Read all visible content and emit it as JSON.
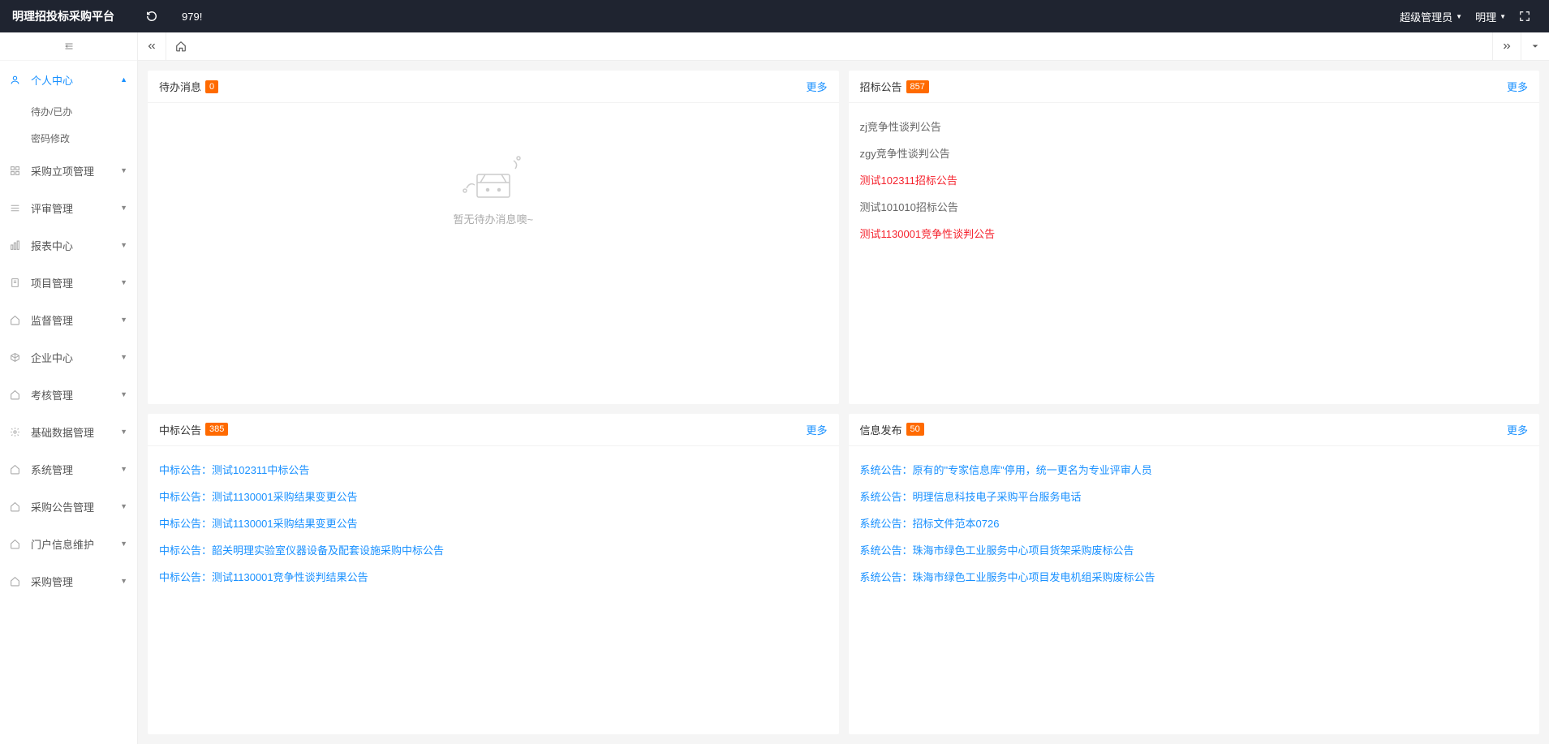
{
  "header": {
    "logo": "明理招投标采购平台",
    "ticker": "979!",
    "role": "超级管理员",
    "user": "明理"
  },
  "sidebar": {
    "items": [
      {
        "label": "个人中心",
        "active": true,
        "expanded": true,
        "sub": [
          {
            "label": "待办/已办"
          },
          {
            "label": "密码修改"
          }
        ]
      },
      {
        "label": "采购立项管理"
      },
      {
        "label": "评审管理"
      },
      {
        "label": "报表中心"
      },
      {
        "label": "项目管理"
      },
      {
        "label": "监督管理"
      },
      {
        "label": "企业中心"
      },
      {
        "label": "考核管理"
      },
      {
        "label": "基础数据管理"
      },
      {
        "label": "系统管理"
      },
      {
        "label": "采购公告管理"
      },
      {
        "label": "门户信息维护"
      },
      {
        "label": "采购管理"
      }
    ]
  },
  "panel_todo": {
    "title": "待办消息",
    "badge": "0",
    "more": "更多",
    "empty": "暂无待办消息噢~"
  },
  "panel_tender": {
    "title": "招标公告",
    "badge": "857",
    "more": "更多",
    "items": [
      {
        "text": "zj竞争性谈判公告",
        "cls": "plain"
      },
      {
        "text": "zgy竞争性谈判公告",
        "cls": "plain"
      },
      {
        "text": "测试102311招标公告",
        "cls": "red"
      },
      {
        "text": "测试101010招标公告",
        "cls": "plain"
      },
      {
        "text": "测试1130001竞争性谈判公告",
        "cls": "red"
      }
    ]
  },
  "panel_win": {
    "title": "中标公告",
    "badge": "385",
    "more": "更多",
    "items": [
      {
        "text": "中标公告：测试102311中标公告",
        "cls": "link"
      },
      {
        "text": "中标公告：测试1130001采购结果变更公告",
        "cls": "link"
      },
      {
        "text": "中标公告：测试1130001采购结果变更公告",
        "cls": "link"
      },
      {
        "text": "中标公告：韶关明理实验室仪器设备及配套设施采购中标公告",
        "cls": "link"
      },
      {
        "text": "中标公告：测试1130001竞争性谈判结果公告",
        "cls": "link"
      }
    ]
  },
  "panel_info": {
    "title": "信息发布",
    "badge": "50",
    "more": "更多",
    "items": [
      {
        "text": "系统公告：原有的\"专家信息库\"停用，统一更名为专业评审人员",
        "cls": "link"
      },
      {
        "text": "系统公告：明理信息科技电子采购平台服务电话",
        "cls": "link"
      },
      {
        "text": "系统公告：招标文件范本0726",
        "cls": "link"
      },
      {
        "text": "系统公告：珠海市绿色工业服务中心项目货架采购废标公告",
        "cls": "link"
      },
      {
        "text": "系统公告：珠海市绿色工业服务中心项目发电机组采购废标公告",
        "cls": "link"
      }
    ]
  }
}
